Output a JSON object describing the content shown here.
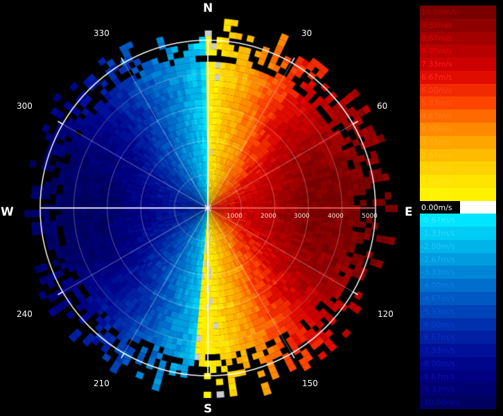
{
  "radar": {
    "cardinals": {
      "north": "N",
      "east": "E",
      "south": "S",
      "west": "W"
    },
    "angle_labels": [
      "30",
      "60",
      "120",
      "150",
      "210",
      "240",
      "300",
      "330"
    ],
    "range_labels": [
      "1000",
      "2000",
      "3000",
      "4000",
      "5000"
    ],
    "colors": {
      "ring": "#ffffff",
      "zero_line": "#ff4d4d",
      "background": "#000000"
    }
  },
  "legend": {
    "entries": [
      {
        "label": "10.00m/s",
        "color": "#7a0000",
        "text_color": "#b00000"
      },
      {
        "label": "9.33m/s",
        "color": "#8e0000",
        "text_color": "#d00000"
      },
      {
        "label": "8.67m/s",
        "color": "#a30000",
        "text_color": "#e00000"
      },
      {
        "label": "8.00m/s",
        "color": "#b80000",
        "text_color": "#f00000"
      },
      {
        "label": "7.33m/s",
        "color": "#cc0000",
        "text_color": "#ff1a1a"
      },
      {
        "label": "6.67m/s",
        "color": "#e00c00",
        "text_color": "#ff2a1a"
      },
      {
        "label": "6.00m/s",
        "color": "#f22a00",
        "text_color": "#ff3d1a"
      },
      {
        "label": "5.33m/s",
        "color": "#ff4500",
        "text_color": "#ff5a1a"
      },
      {
        "label": "4.67m/s",
        "color": "#ff6a00",
        "text_color": "#ff7a1a"
      },
      {
        "label": "4.00m/s",
        "color": "#ff8a00",
        "text_color": "#ff9a1a"
      },
      {
        "label": "3.33m/s",
        "color": "#ffa500",
        "text_color": "#ffb21a"
      },
      {
        "label": "2.67m/s",
        "color": "#ffbb00",
        "text_color": "#ffc61a"
      },
      {
        "label": "2.00m/s",
        "color": "#ffd100",
        "text_color": "#ffd91a"
      },
      {
        "label": "1.33m/s",
        "color": "#ffe400",
        "text_color": "#ffe81a"
      },
      {
        "label": "0.67m/s",
        "color": "#fff200",
        "text_color": "#fff21a"
      },
      {
        "label": "0.00m/s",
        "color": "#ffffff",
        "text_color": "#ffffff"
      },
      {
        "label": "-0.67m/s",
        "color": "#00e5ff",
        "text_color": "#40e8ff"
      },
      {
        "label": "-1.33m/s",
        "color": "#00ccf5",
        "text_color": "#2ad8ff"
      },
      {
        "label": "-2.00m/s",
        "color": "#00b4ea",
        "text_color": "#1ec6ff"
      },
      {
        "label": "-2.67m/s",
        "color": "#009ce0",
        "text_color": "#18b0f5"
      },
      {
        "label": "-3.33m/s",
        "color": "#0085d6",
        "text_color": "#1098ee"
      },
      {
        "label": "-4.00m/s",
        "color": "#006ecc",
        "text_color": "#0a80e6"
      },
      {
        "label": "-4.67m/s",
        "color": "#0058c2",
        "text_color": "#0a6ade"
      },
      {
        "label": "-5.33m/s",
        "color": "#0043b8",
        "text_color": "#0a55d6"
      },
      {
        "label": "-6.00m/s",
        "color": "#0030ad",
        "text_color": "#0a40ce"
      },
      {
        "label": "-6.67m/s",
        "color": "#001fa3",
        "text_color": "#0a30c6"
      },
      {
        "label": "-7.33m/s",
        "color": "#001099",
        "text_color": "#0a22be"
      },
      {
        "label": "-8.00m/s",
        "color": "#00068c",
        "text_color": "#0a18b6"
      },
      {
        "label": "-8.67m/s",
        "color": "#000080",
        "text_color": "#0a10ae"
      },
      {
        "label": "-9.33m/s",
        "color": "#000070",
        "text_color": "#0a0aa6"
      },
      {
        "label": "-10.00m/s",
        "color": "#000060",
        "text_color": "#08089e"
      }
    ]
  }
}
